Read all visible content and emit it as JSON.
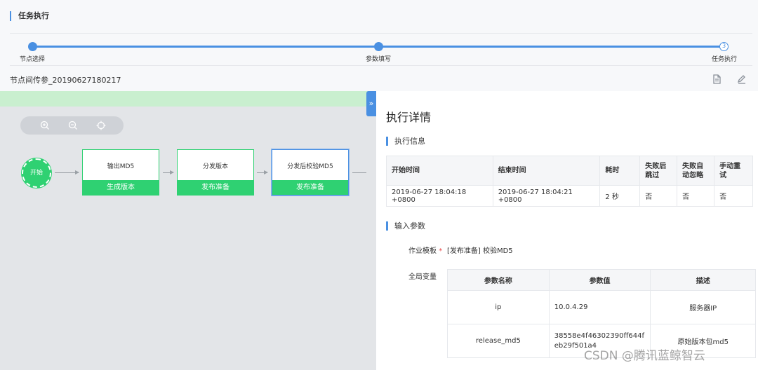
{
  "header": {
    "title": "任务执行"
  },
  "steps": [
    {
      "label": "节点选择"
    },
    {
      "label": "参数填写"
    },
    {
      "label": "任务执行",
      "number": "3"
    }
  ],
  "toolbar": {
    "task_name": "节点间传参_20190627180217"
  },
  "canvas": {
    "start_label": "开始",
    "nodes": [
      {
        "title": "输出MD5",
        "tag": "生成版本"
      },
      {
        "title": "分发版本",
        "tag": "发布准备"
      },
      {
        "title": "分发后校验MD5",
        "tag": "发布准备"
      }
    ]
  },
  "panel": {
    "collapse_glyph": "»",
    "title": "执行详情",
    "exec_section": "执行信息",
    "exec_table": {
      "headers": [
        "开始时间",
        "结束时间",
        "耗时",
        "失败后跳过",
        "失败自动忽略",
        "手动重试"
      ],
      "row": [
        "2019-06-27 18:04:18 +0800",
        "2019-06-27 18:04:21 +0800",
        "2 秒",
        "否",
        "否",
        "否"
      ]
    },
    "input_section": "输入参数",
    "template_label": "作业模板",
    "template_required": "*",
    "template_value": "[发布准备] 校验MD5",
    "global_label": "全局变量",
    "var_table": {
      "headers": [
        "参数名称",
        "参数值",
        "描述"
      ],
      "rows": [
        {
          "name": "ip",
          "value": "10.0.4.29",
          "desc": "服务器IP"
        },
        {
          "name": "release_md5",
          "value": "38558e4f46302390ff644feb29f501a4",
          "desc": "原始版本包md5"
        }
      ]
    }
  },
  "watermark": "CSDN @腾讯蓝鲸智云",
  "colors": {
    "accent": "#4a90e2",
    "success": "#2fd172",
    "canvas_bg": "#e3e5e8"
  }
}
